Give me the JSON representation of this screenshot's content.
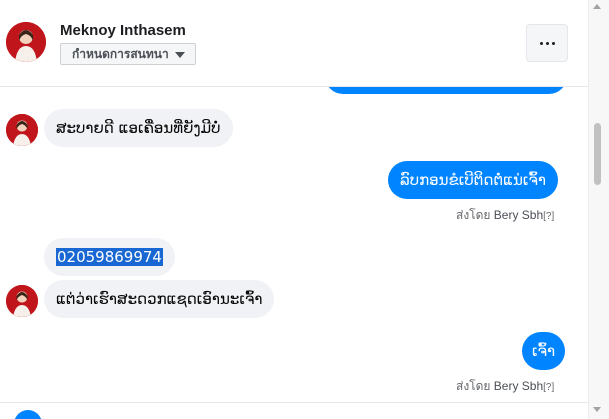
{
  "header": {
    "contact_name": "Meknoy Inthasem",
    "nickname_button": "กำหนดการสนทนา",
    "more_button_icon": "more-options-icon"
  },
  "thread": {
    "messages": [
      {
        "direction": "incoming",
        "text": "ສະບາຍດີ ແອເຄື່ອນທີ່ຍັງມີບໍ່"
      },
      {
        "direction": "outgoing",
        "text": "ລົບກອນຂໍເບີຕິດຕໍ່ແນ່ເຈົ້າ"
      },
      {
        "direction": "incoming",
        "text": "02059869974",
        "selected": true
      },
      {
        "direction": "incoming",
        "text": "ແຕ່ວ່າເຮົາສະດວກແຊດເອົານະເຈົ້າ"
      },
      {
        "direction": "outgoing",
        "text": "ເຈົ້າ"
      }
    ],
    "sent_by_1": {
      "prefix": "ส่งโดย",
      "name": "Bery Sbh",
      "marker": "[?]"
    },
    "sent_by_2": {
      "prefix": "ส่งโดย",
      "name": "Bery Sbh",
      "marker": "[?]"
    }
  },
  "colors": {
    "outgoing_bubble": "#0084ff",
    "incoming_bubble": "#f0f2f5",
    "selection": "#1967d2"
  }
}
